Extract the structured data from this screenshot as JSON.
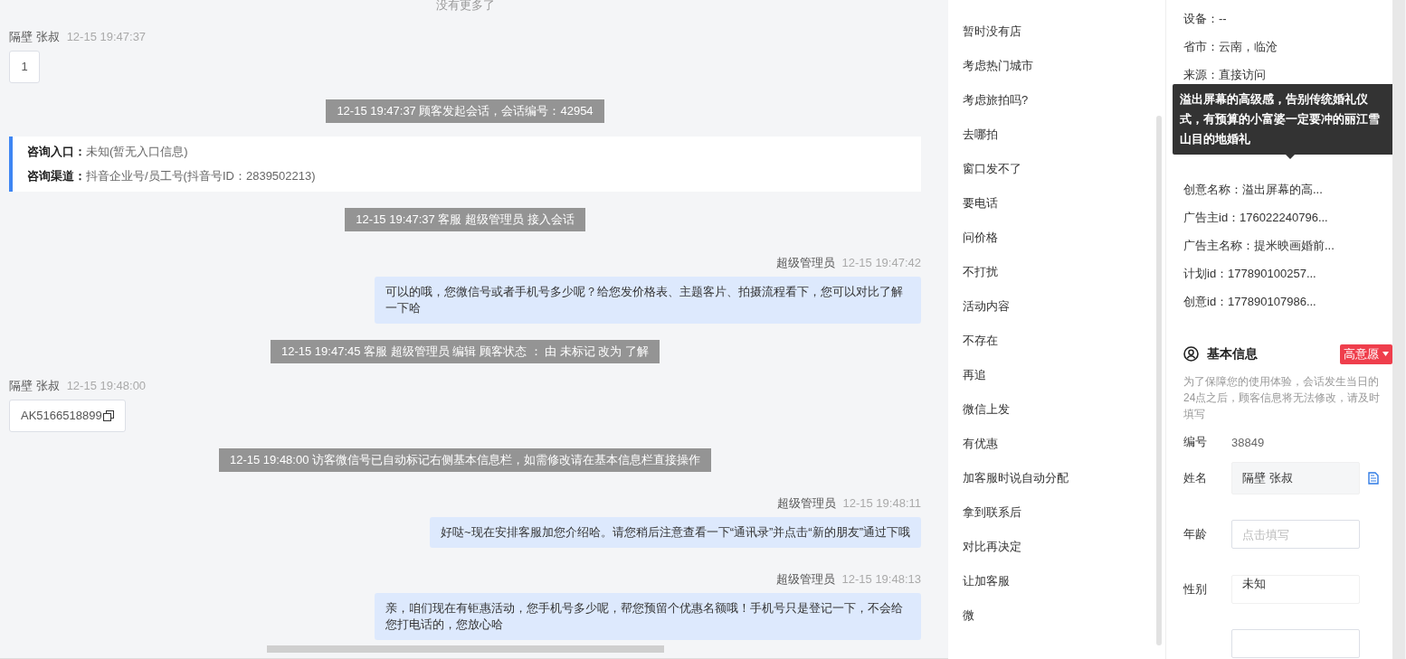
{
  "chat": {
    "top_note": "没有更多了",
    "messages": [
      {
        "kind": "customer",
        "name": "隔壁 张叔",
        "time": "12-15 19:47:37",
        "text": "1",
        "copyable": false
      },
      {
        "kind": "system",
        "text": "12-15 19:47:37 顾客发起会话，会话编号：42954"
      },
      {
        "kind": "info_card",
        "lines": [
          {
            "label": "咨询入口：",
            "value": "未知(暂无入口信息)"
          },
          {
            "label": "咨询渠道：",
            "value": "抖音企业号/员工号(抖音号ID：2839502213)"
          }
        ]
      },
      {
        "kind": "system",
        "text": "12-15 19:47:37 客服 超级管理员 接入会话"
      },
      {
        "kind": "agent",
        "name": "超级管理员",
        "time": "12-15 19:47:42",
        "text": "可以的哦，您微信号或者手机号多少呢？给您发价格表、主题客片、拍摄流程看下，您可以对比了解一下哈"
      },
      {
        "kind": "system",
        "text": "12-15 19:47:45 客服 超级管理员 编辑 顾客状态 ： 由 未标记 改为 了解"
      },
      {
        "kind": "customer",
        "name": "隔壁 张叔",
        "time": "12-15 19:48:00",
        "text": "AK5166518899",
        "copyable": true
      },
      {
        "kind": "system",
        "text": "12-15 19:48:00 访客微信号已自动标记右侧基本信息栏，如需修改请在基本信息栏直接操作"
      },
      {
        "kind": "agent",
        "name": "超级管理员",
        "time": "12-15 19:48:11",
        "text": "好哒~现在安排客服加您介绍哈。请您稍后注意查看一下“通讯录”并点击“新的朋友”通过下哦"
      },
      {
        "kind": "agent",
        "name": "超级管理员",
        "time": "12-15 19:48:13",
        "text": "亲，咱们现在有钜惠活动，您手机号多少呢，帮您预留个优惠名额哦！手机号只是登记一下，不会给您打电话的，您放心哈"
      }
    ]
  },
  "quick_replies": [
    "暂时没有店",
    "考虑热门城市",
    "考虑旅拍吗?",
    "去哪拍",
    "窗口发不了",
    "要电话",
    "问价格",
    "不打扰",
    "活动内容",
    "不存在",
    "再追",
    "微信上发",
    "有优惠",
    "加客服时说自动分配",
    "拿到联系后",
    "对比再决定",
    "让加客服",
    "微"
  ],
  "visitor_info": {
    "rows_before": [
      "设备：--",
      "省市：云南，临沧",
      "来源：直接访问"
    ],
    "tooltip": "溢出屏幕的高级感，告别传统婚礼仪式，有预算的小富婆一定要冲的丽江雪山目的地婚礼",
    "rows_after": [
      "创意名称：溢出屏幕的高...",
      "广告主id：176022240796...",
      "广告主名称：提米映画婚前...",
      "计划id：177890100257...",
      "创意id：177890107986..."
    ]
  },
  "basic_info": {
    "title": "基本信息",
    "intent_tag": "高意愿",
    "note": "为了保障您的使用体验，会话发生当日的24点之后，顾客信息将无法修改，请及时填写",
    "fields": [
      {
        "kind": "text",
        "label": "编号",
        "value": "38849"
      },
      {
        "kind": "readonly",
        "label": "姓名",
        "value": "隔壁 张叔"
      },
      {
        "kind": "input",
        "label": "年龄",
        "placeholder": "点击填写"
      },
      {
        "kind": "select",
        "label": "性别",
        "value": "未知"
      },
      {
        "kind": "input_cut"
      }
    ]
  }
}
